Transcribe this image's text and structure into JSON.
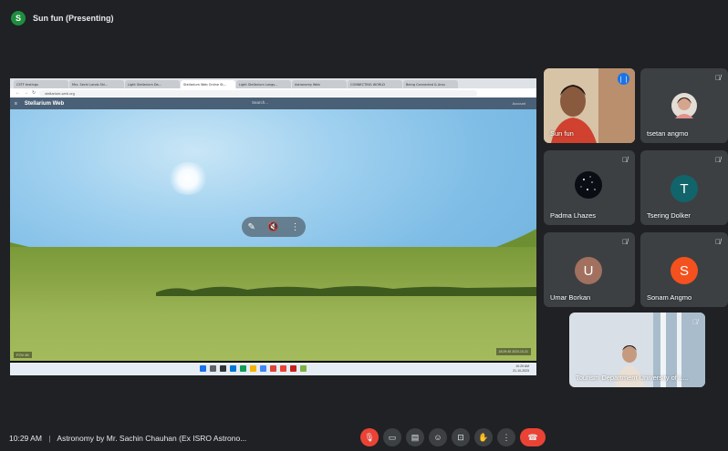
{
  "header": {
    "presenter_initial": "S",
    "title": "Sun fun (Presenting)"
  },
  "shared_screen": {
    "browser_tabs": [
      "CSTF testings",
      "Mrs. Sechi Lands Shi...",
      "Light Stellarium Da...",
      "Stellarium Web Online St...",
      "Light Stellarium Longs...",
      "Astronomy Web",
      "CONNECTING WORLD",
      "Being Connected & Ansc"
    ],
    "url": "stellarium-web.org",
    "app_name": "Stellarium Web",
    "search_placeholder": "Search...",
    "account_label": "Account",
    "fov_label": "FOV 60",
    "datetime_label": "18:29:45 2023-10-21",
    "tray_time": "10:29 AM",
    "tray_date": "Saturday",
    "tray_date2": "21-10-2023"
  },
  "participants": [
    {
      "name": "Sun fun",
      "type": "video",
      "speaking": true
    },
    {
      "name": "tsetan angmo",
      "type": "photo",
      "muted": true
    },
    {
      "name": "Padma Lhazes",
      "type": "photo",
      "muted": true
    },
    {
      "name": "Tsering Dolker",
      "initial": "T",
      "color": "#12646b",
      "muted": true
    },
    {
      "name": "Umar Borkan",
      "initial": "U",
      "color": "#a1705f",
      "muted": true
    },
    {
      "name": "Sonam Angmo",
      "initial": "S",
      "color": "#f4511e",
      "muted": true
    },
    {
      "name": "Tourism Department University of L...",
      "type": "video",
      "muted": true
    }
  ],
  "footer": {
    "time": "10:29 AM",
    "separator": "|",
    "meeting_title": "Astronomy by Mr. Sachin Chauhan (Ex ISRO Astrono..."
  },
  "icons": {
    "mic_off": "mic-off-icon",
    "camera": "camera-icon",
    "captions": "captions-icon",
    "emoji": "emoji-icon",
    "present": "present-icon",
    "hand": "raise-hand-icon",
    "more": "more-options-icon",
    "end_call": "end-call-icon"
  }
}
